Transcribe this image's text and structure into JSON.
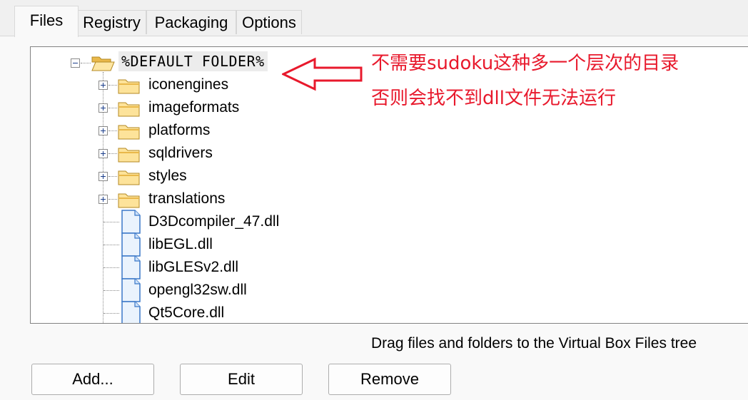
{
  "tabs": [
    {
      "label": "Files",
      "active": true
    },
    {
      "label": "Registry",
      "active": false
    },
    {
      "label": "Packaging",
      "active": false
    },
    {
      "label": "Options",
      "active": false
    }
  ],
  "tree": {
    "root": {
      "label": "%DEFAULT FOLDER%",
      "expanded": true,
      "icon": "open-folder-icon"
    },
    "folders": [
      "iconengines",
      "imageformats",
      "platforms",
      "sqldrivers",
      "styles",
      "translations"
    ],
    "files": [
      "D3Dcompiler_47.dll",
      "libEGL.dll",
      "libGLESv2.dll",
      "opengl32sw.dll",
      "Qt5Core.dll"
    ]
  },
  "annotation": {
    "line1": "不需要sudoku这种多一个层次的目录",
    "line2": "否则会找不到dll文件无法运行",
    "color": "#e8192c"
  },
  "hint": "Drag files and folders to the Virtual Box Files tree",
  "buttons": {
    "add": "Add...",
    "edit": "Edit",
    "remove": "Remove"
  }
}
